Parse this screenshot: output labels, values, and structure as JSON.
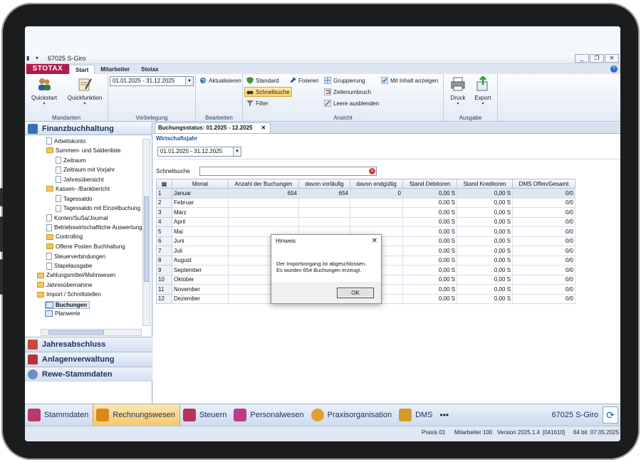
{
  "window": {
    "title": "67025 S-Giro",
    "controls": [
      "_",
      "❐",
      "✕"
    ]
  },
  "ribbon": {
    "logo": "STOTAX",
    "tabs": [
      "Start",
      "Mitarbeiter",
      "Stotax"
    ],
    "groups": {
      "mandanten": {
        "label": "Mandanten",
        "quickstart": "Quickstart",
        "quickfunktion": "Quickfunktion"
      },
      "vorbelegung": {
        "label": "Vorbelegung",
        "period": "01.01.2025 - 31.12.2025"
      },
      "bearbeiten": {
        "label": "Bearbeiten",
        "aktualisieren": "Aktualisieren"
      },
      "ansicht": {
        "label": "Ansicht",
        "standard": "Standard",
        "schnellsuche": "Schnellsuche",
        "filter": "Filter",
        "fixieren": "Fixieren",
        "gruppierung": "Gruppierung",
        "zeilenumbruch": "Zeilenumbruch",
        "leere_ausblenden": "Leere ausblenden",
        "mit_inhalt": "Mit Inhalt anzeigen"
      },
      "ausgabe": {
        "label": "Ausgabe",
        "druck": "Druck",
        "export": "Export"
      }
    }
  },
  "nav": {
    "header": "Finanzbuchhaltung",
    "tree": [
      {
        "label": "Arbeitskonto",
        "type": "doc",
        "level": 2
      },
      {
        "label": "Summen- und Saldenliste",
        "type": "folder",
        "level": 2
      },
      {
        "label": "Zeitraum",
        "type": "doc",
        "level": 3
      },
      {
        "label": "Zeitraum mit Vorjahr",
        "type": "doc",
        "level": 3
      },
      {
        "label": "Jahresübersicht",
        "type": "doc",
        "level": 3
      },
      {
        "label": "Kassen- /Bankbericht",
        "type": "folder",
        "level": 2
      },
      {
        "label": "Tagessaldo",
        "type": "doc",
        "level": 3
      },
      {
        "label": "Tagessaldo mit Einzelbuchung",
        "type": "doc",
        "level": 3
      },
      {
        "label": "Konten/SuSa/Journal",
        "type": "doc",
        "level": 2
      },
      {
        "label": "Betriebswirtschaftliche Auswertung",
        "type": "doc",
        "level": 2
      },
      {
        "label": "Controlling",
        "type": "folder",
        "level": 2
      },
      {
        "label": "Offene Posten Buchhaltung",
        "type": "folder",
        "level": 2
      },
      {
        "label": "Steuerverbindungen",
        "type": "doc",
        "level": 2
      },
      {
        "label": "Stapelausgabe",
        "type": "doc",
        "level": 2
      },
      {
        "label": "Zahlungsmittel/Mahnwesen",
        "type": "folder",
        "level": 1
      },
      {
        "label": "Jahresübernahme",
        "type": "folder",
        "level": 1
      },
      {
        "label": "Import / Schnittstellen",
        "type": "folder",
        "level": 1
      },
      {
        "label": "Buchungen",
        "type": "grid",
        "level": 2
      },
      {
        "label": "Planwerte",
        "type": "grid",
        "level": 2
      }
    ],
    "sections": [
      "Jahresabschluss",
      "Anlagenverwaltung",
      "Rewe-Stammdaten"
    ]
  },
  "main": {
    "tab_title": "Buchungsstatus: 01.2025 - 12.2025",
    "panel_label": "Wirtschaftsjahr",
    "year_value": "01.01.2025 - 31.12.2025",
    "search_label": "Schnellsuche",
    "columns": [
      "Monat",
      "Anzahl der Buchungen",
      "davon vorläufig",
      "davon endgültig",
      "Stand Debitoren",
      "Stand Kreditoren",
      "DMS Offen/Gesamt"
    ],
    "rows": [
      {
        "n": "1",
        "monat": "Januar",
        "anzahl": "654",
        "vorl": "654",
        "endg": "0",
        "deb": "0,00 S",
        "kred": "0,00 S",
        "dms": "0/0"
      },
      {
        "n": "2",
        "monat": "Februar",
        "anzahl": "",
        "vorl": "",
        "endg": "",
        "deb": "0,00 S",
        "kred": "0,00 S",
        "dms": "0/0"
      },
      {
        "n": "3",
        "monat": "März",
        "anzahl": "",
        "vorl": "",
        "endg": "",
        "deb": "0,00 S",
        "kred": "0,00 S",
        "dms": "0/0"
      },
      {
        "n": "4",
        "monat": "April",
        "anzahl": "",
        "vorl": "",
        "endg": "",
        "deb": "0,00 S",
        "kred": "0,00 S",
        "dms": "0/0"
      },
      {
        "n": "5",
        "monat": "Mai",
        "anzahl": "",
        "vorl": "",
        "endg": "",
        "deb": "0,00 S",
        "kred": "0,00 S",
        "dms": "0/0"
      },
      {
        "n": "6",
        "monat": "Juni",
        "anzahl": "",
        "vorl": "",
        "endg": "",
        "deb": "0,00 S",
        "kred": "0,00 S",
        "dms": "0/0"
      },
      {
        "n": "7",
        "monat": "Juli",
        "anzahl": "",
        "vorl": "",
        "endg": "",
        "deb": "0,00 S",
        "kred": "0,00 S",
        "dms": "0/0"
      },
      {
        "n": "8",
        "monat": "August",
        "anzahl": "",
        "vorl": "",
        "endg": "",
        "deb": "0,00 S",
        "kred": "0,00 S",
        "dms": "0/0"
      },
      {
        "n": "9",
        "monat": "September",
        "anzahl": "",
        "vorl": "",
        "endg": "",
        "deb": "0,00 S",
        "kred": "0,00 S",
        "dms": "0/0"
      },
      {
        "n": "10",
        "monat": "Oktober",
        "anzahl": "",
        "vorl": "",
        "endg": "",
        "deb": "0,00 S",
        "kred": "0,00 S",
        "dms": "0/0"
      },
      {
        "n": "11",
        "monat": "November",
        "anzahl": "",
        "vorl": "",
        "endg": "",
        "deb": "0,00 S",
        "kred": "0,00 S",
        "dms": "0/0"
      },
      {
        "n": "12",
        "monat": "Dezember",
        "anzahl": "",
        "vorl": "",
        "endg": "",
        "deb": "0,00 S",
        "kred": "0,00 S",
        "dms": "0/0"
      }
    ]
  },
  "dialog": {
    "title": "Hinweis",
    "line1": "Der Importvorgang ist abgeschlossen.",
    "line2": "Es wurden 654 Buchungen erzeugt.",
    "ok": "OK"
  },
  "modules": [
    {
      "label": "Stammdaten",
      "color": "#b83a6a",
      "active": false
    },
    {
      "label": "Rechnungswesen",
      "color": "#d68a1a",
      "active": true
    },
    {
      "label": "Steuern",
      "color": "#b8325a",
      "active": false
    },
    {
      "label": "Personalwesen",
      "color": "#c0398a",
      "active": false
    },
    {
      "label": "Praxisorganisation",
      "color": "#e0a030",
      "active": false
    },
    {
      "label": "DMS",
      "color": "#d69a2a",
      "active": false
    }
  ],
  "modbar": {
    "dots": "•••",
    "appname": "67025 S-Giro"
  },
  "status": {
    "praxis": "Praxis 01",
    "mitarbeiter": "Mitarbeiter 100",
    "version": "Version 2025.1.4",
    "build": "[041610]",
    "bits": "64 bit",
    "date": "07.05.2025"
  }
}
